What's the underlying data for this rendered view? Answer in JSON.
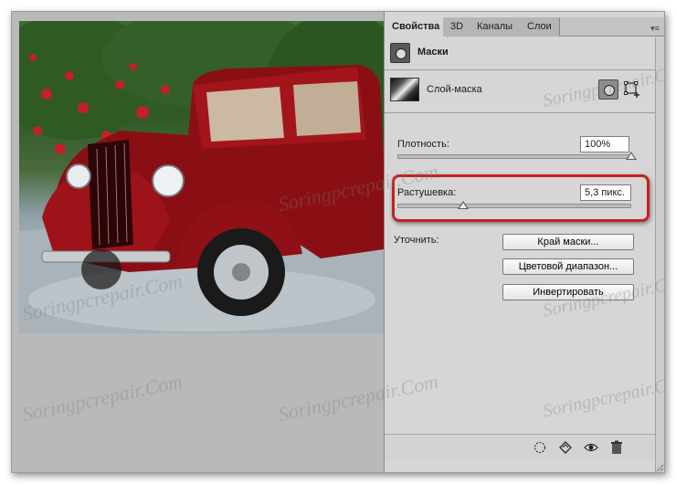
{
  "panel": {
    "tabs": [
      {
        "label": "Свойства",
        "active": true
      },
      {
        "label": "3D",
        "active": false
      },
      {
        "label": "Каналы",
        "active": false
      },
      {
        "label": "Слои",
        "active": false
      }
    ],
    "menu_icon": "panel-menu-icon",
    "header_title": "Маски",
    "layer_label": "Слой-маска",
    "density": {
      "label": "Плотность:",
      "value": "100%",
      "level": 1.0
    },
    "feather": {
      "label": "Растушевка:",
      "value": "5,3 пикс.",
      "level": 0.28
    },
    "refine_label": "Уточнить:",
    "buttons": {
      "mask_edge": "Край маски...",
      "color_range": "Цветовой диапазон...",
      "invert": "Инвертировать"
    },
    "bottom_icons": [
      "load-selection-icon",
      "apply-mask-icon",
      "visibility-eye-icon",
      "trash-icon"
    ]
  },
  "watermark_text": "Soringpcrepair.Com",
  "colors": {
    "highlight": "#c8201e",
    "panel_bg": "#d6d6d6",
    "canvas_bg": "#b9b9b9"
  }
}
